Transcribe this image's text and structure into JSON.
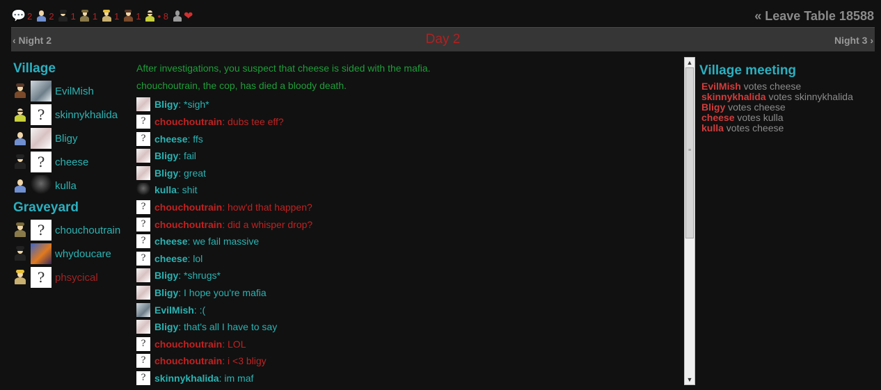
{
  "top_counts": [
    {
      "icon": "chat-bubble-icon",
      "count": "2"
    },
    {
      "icon": "villager-icon",
      "count": "2"
    },
    {
      "icon": "mafia-icon",
      "count": "1"
    },
    {
      "icon": "cop-icon",
      "count": "1"
    },
    {
      "icon": "king-icon",
      "count": "1"
    },
    {
      "icon": "hunter-icon",
      "count": "1"
    },
    {
      "icon": "player-icon",
      "count": "• 8"
    }
  ],
  "leave_table": "« Leave Table 18588",
  "nav": {
    "prev": "‹ Night 2",
    "current": "Day 2",
    "next": "Night 3 ›"
  },
  "village": {
    "title": "Village",
    "players": [
      {
        "name": "EvilMish",
        "role": "hunter"
      },
      {
        "name": "skinnykhalida",
        "role": "villager-yellow"
      },
      {
        "name": "Bligy",
        "role": "villager"
      },
      {
        "name": "cheese",
        "role": "mafia"
      },
      {
        "name": "kulla",
        "role": "villager"
      }
    ]
  },
  "graveyard": {
    "title": "Graveyard",
    "players": [
      {
        "name": "chouchoutrain",
        "role": "cop"
      },
      {
        "name": "whydoucare",
        "role": "mafia"
      },
      {
        "name": "phsycical",
        "role": "king"
      }
    ]
  },
  "system_messages": [
    "After investigations, you suspect that cheese is sided with the mafia.",
    "chouchoutrain, the cop, has died a bloody death."
  ],
  "messages": [
    {
      "who": "Bligy",
      "text": ": *sigh*"
    },
    {
      "who": "chouchoutrain",
      "text": ": dubs tee eff?"
    },
    {
      "who": "cheese",
      "text": ": ffs"
    },
    {
      "who": "Bligy",
      "text": ": fail"
    },
    {
      "who": "Bligy",
      "text": ": great"
    },
    {
      "who": "kulla",
      "text": ": shit"
    },
    {
      "who": "chouchoutrain",
      "text": ": how'd that happen?"
    },
    {
      "who": "chouchoutrain",
      "text": ": did a whisper drop?"
    },
    {
      "who": "cheese",
      "text": ": we fail massive"
    },
    {
      "who": "cheese",
      "text": ": lol"
    },
    {
      "who": "Bligy",
      "text": ": *shrugs*"
    },
    {
      "who": "Bligy",
      "text": ": I hope you're mafia"
    },
    {
      "who": "EvilMish",
      "text": ": :("
    },
    {
      "who": "Bligy",
      "text": ": that's all I have to say"
    },
    {
      "who": "chouchoutrain",
      "text": ": LOL"
    },
    {
      "who": "chouchoutrain",
      "text": ": i <3 bligy"
    },
    {
      "who": "skinnykhalida",
      "text": ": im maf"
    }
  ],
  "meeting": {
    "title": "Village meeting",
    "votes": [
      {
        "voter": "EvilMish",
        "rest": " votes cheese"
      },
      {
        "voter": "skinnykhalida",
        "rest": " votes skinnykhalida"
      },
      {
        "voter": "Bligy",
        "rest": " votes cheese"
      },
      {
        "voter": "cheese",
        "rest": " votes kulla"
      },
      {
        "voter": "kulla",
        "rest": " votes cheese"
      }
    ]
  },
  "colors": {
    "teal": "#2bb3b3",
    "red": "#c12222",
    "green": "#1f9e3a",
    "bg": "#111111"
  }
}
